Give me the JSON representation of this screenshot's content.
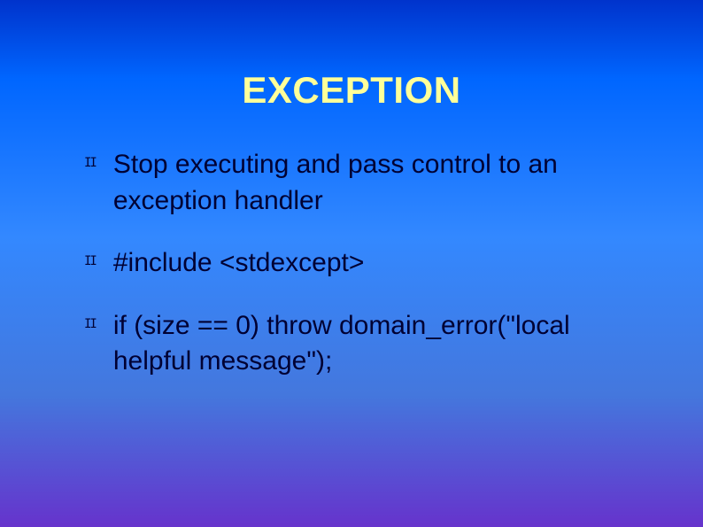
{
  "slide": {
    "title": "EXCEPTION",
    "bullets": [
      "Stop executing and pass control to an exception handler",
      "#include <stdexcept>",
      "if (size == 0) throw domain_error(\"local helpful message\");"
    ]
  }
}
